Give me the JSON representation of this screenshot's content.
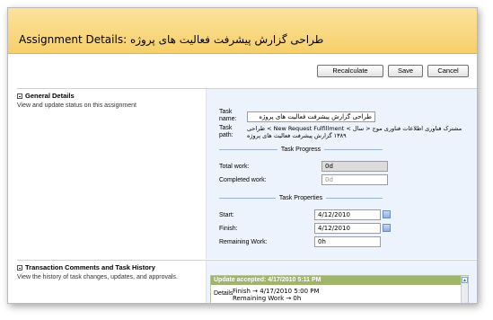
{
  "header": {
    "title": "Assignment Details: طراحی گزارش پیشرفت فعالیت های پروژه"
  },
  "toolbar": {
    "recalculate": "Recalculate",
    "save": "Save",
    "cancel": "Cancel"
  },
  "general": {
    "title": "General Details",
    "description": "View and update status on this assignment",
    "task_name_label": "Task name:",
    "task_name_value": "طراحی گزارش پیشرفت فعالیت های پروژه",
    "task_path_label": "Task path:",
    "task_path_value": "طراحی < New Request Fulfillment < مشترک فناوری اطلاعات فناوری موج < سال ۱۳۸۹ گزارش پیشرفت فعالیت های پروژه",
    "progress_group": "Task Progress",
    "total_work_label": "Total work:",
    "total_work_value": "0d",
    "completed_work_label": "Completed work:",
    "completed_work_value": "0d",
    "properties_group": "Task Properties",
    "start_label": "Start:",
    "start_value": "4/12/2010",
    "finish_label": "Finish:",
    "finish_value": "4/12/2010",
    "remaining_label": "Remaining Work:",
    "remaining_value": "0h"
  },
  "history": {
    "title": "Transaction Comments and Task History",
    "description": "View the history of task changes, updates, and approvals.",
    "entry_header": "Update accepted: 4/17/2010 5:11 PM",
    "details_label": "Details",
    "lines": [
      "Finish → 4/17/2010 5:00 PM",
      "Remaining Work → 0h"
    ]
  },
  "colors": {
    "title_bar": "#f7cf6b",
    "panel_bg": "#ecf3fc",
    "history_header": "#9fb56a"
  },
  "icons": [
    "collapse-icon",
    "calendar-icon",
    "scroll-up-icon"
  ]
}
